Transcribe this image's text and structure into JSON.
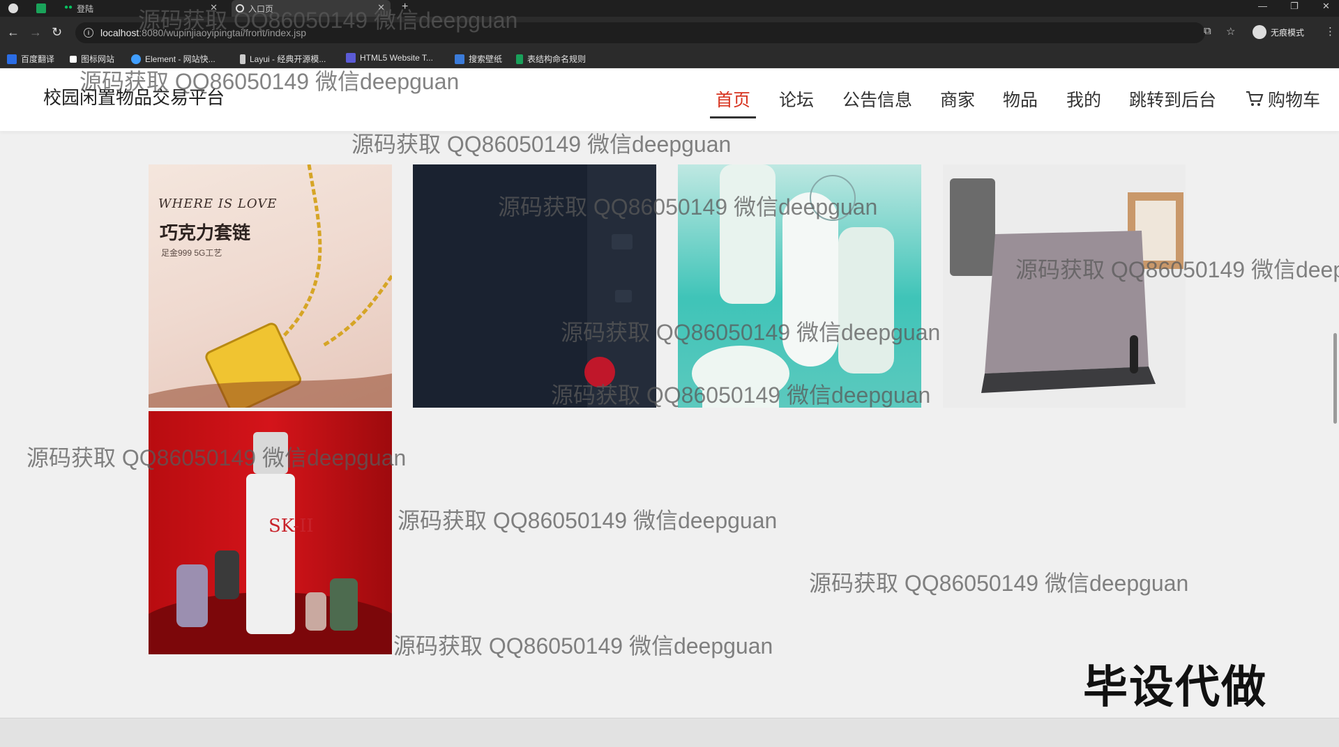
{
  "browser": {
    "tabs": [
      {
        "label": ""
      },
      {
        "label": ""
      },
      {
        "label": "登陆"
      },
      {
        "label": "入口页"
      }
    ],
    "url_host": "localhost",
    "url_path": ":8080/wupinjiaoyipingtai/front/index.jsp",
    "profile_label": "无痕模式",
    "bookmarks": [
      {
        "label": "百度翻译",
        "color": "#2b6de5"
      },
      {
        "label": "图标网站",
        "color": "#ffffff"
      },
      {
        "label": "Element - 网站快...",
        "color": "#409eff"
      },
      {
        "label": "Layui - 经典开源模...",
        "color": "#cccccc"
      },
      {
        "label": "HTML5 Website T...",
        "color": "#5b5bd6"
      },
      {
        "label": "搜索壁纸",
        "color": "#3b7bd9"
      },
      {
        "label": "表结构命名规则",
        "color": "#19a05a"
      }
    ]
  },
  "site": {
    "title": "校园闲置物品交易平台",
    "nav": [
      {
        "label": "首页",
        "active": true
      },
      {
        "label": "论坛"
      },
      {
        "label": "公告信息"
      },
      {
        "label": "商家"
      },
      {
        "label": "物品"
      },
      {
        "label": "我的"
      },
      {
        "label": "跳转到后台"
      },
      {
        "label": "购物车"
      }
    ],
    "product1": {
      "t1": "WHERE IS LOVE",
      "t2": "巧克力套链",
      "t3": "足金999   5G工艺"
    },
    "product5": {
      "brand": "SK-II"
    }
  },
  "overlay": {
    "watermark": "源码获取 QQ86050149 微信deepguan",
    "badge": "毕设代做"
  }
}
